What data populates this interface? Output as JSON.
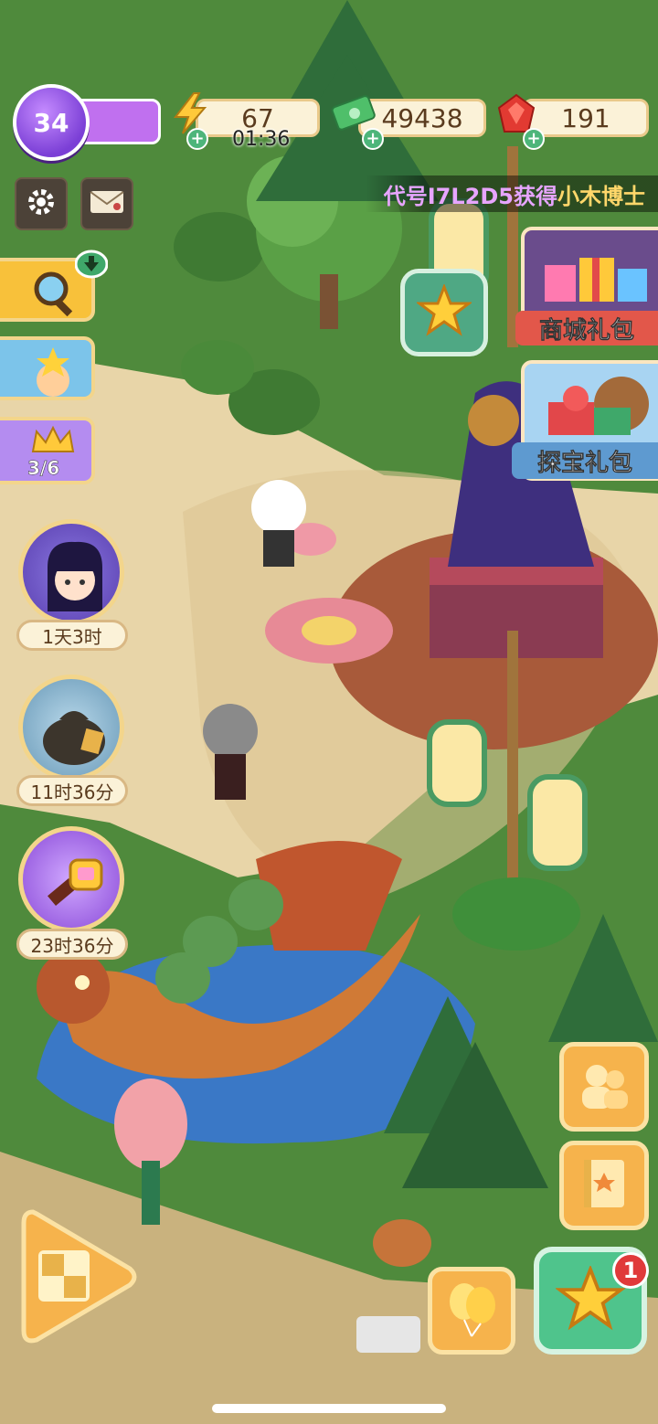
{
  "hud": {
    "level": "34",
    "energy": "67",
    "energy_timer": "01:36",
    "cash": "49438",
    "gems": "191",
    "plus_symbol": "+"
  },
  "ticker": {
    "prefix": "代号I7L2D5获得",
    "reward": "小木博士"
  },
  "left_panel": {
    "event_progress": "3/6",
    "timer_1": "1天3时",
    "timer_2": "11时36分",
    "timer_3": "23时36分"
  },
  "gifts": {
    "shop_pack": "商城礼包",
    "treasure_pack": "探宝礼包"
  },
  "bottom": {
    "tasks_badge": "1"
  },
  "colors": {
    "grass": "#4f8a3c",
    "path": "#e8d5a8",
    "accent_purple": "#7b3fd6",
    "accent_orange": "#f6b34c",
    "accent_green": "#4fc48c"
  }
}
